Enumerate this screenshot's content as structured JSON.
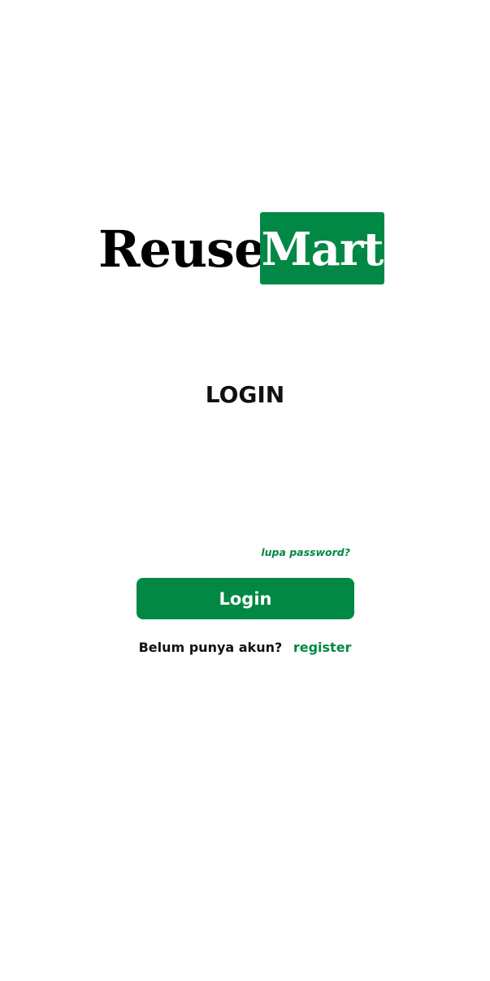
{
  "logo": {
    "word1": "Reuse",
    "word2": "Mart"
  },
  "heading": "LOGIN",
  "forgot_password_link": "lupa password?",
  "login_button_label": "Login",
  "register_prompt": "Belum punya akun?",
  "register_link": "register",
  "colors": {
    "brand_green": "#018844",
    "text_dark": "#111111",
    "background": "#ffffff"
  }
}
